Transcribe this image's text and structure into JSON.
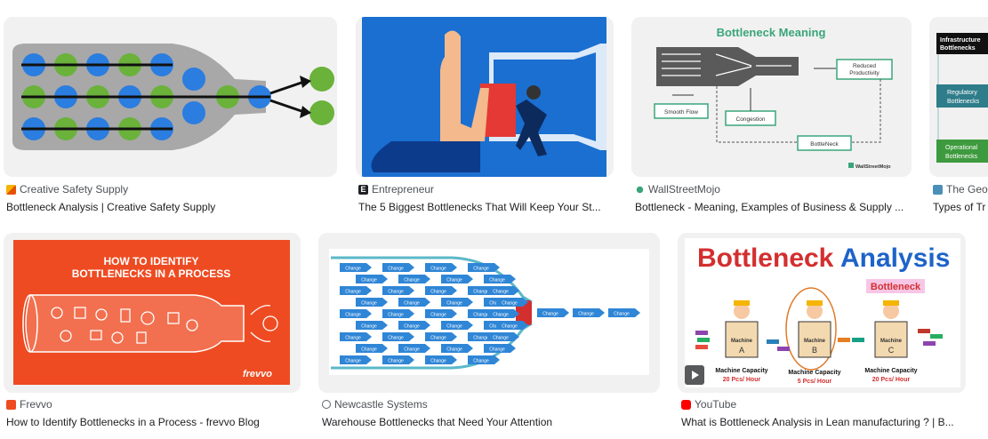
{
  "row1": [
    {
      "source": "Creative Safety Supply",
      "title": "Bottleneck Analysis | Creative Safety Supply"
    },
    {
      "source": "Entrepreneur",
      "title": "The 5 Biggest Bottlenecks That Will Keep Your St..."
    },
    {
      "source": "WallStreetMojo",
      "title": "Bottleneck - Meaning, Examples of Business & Supply ..."
    },
    {
      "source": "The Geo",
      "title": "Types of Tr"
    }
  ],
  "row2": [
    {
      "source": "Frevvo",
      "title": "How to Identify Bottlenecks in a Process - frevvo Blog"
    },
    {
      "source": "Newcastle Systems",
      "title": "Warehouse Bottlenecks that Need Your Attention"
    },
    {
      "source": "YouTube",
      "title": "What is Bottleneck Analysis in Lean manufacturing ? | B..."
    }
  ],
  "images": {
    "wsm": {
      "heading": "Bottleneck Meaning",
      "reduced": "Reduced",
      "productivity": "Productivity",
      "smooth_flow": "Smooth Flow",
      "congestion": "Congestion",
      "bottleneck": "BottleNeck",
      "logo": "WallStreetMojo"
    },
    "geo": {
      "infra1": "Infrastructure",
      "infra2": "Bottlenecks",
      "reg1": "Regulatory",
      "reg2": "Bottlenecks",
      "op1": "Operational",
      "op2": "Bottlenecks"
    },
    "frevvo": {
      "line1": "HOW TO IDENTIFY",
      "line2": "BOTTLENECKS IN A PROCESS",
      "logo": "frevvo"
    },
    "newcastle": {
      "arrow_label": "Change"
    },
    "youtube": {
      "title_part1": "Bottleneck",
      "title_part2": "Analysis",
      "callout": "Bottleneck",
      "machine_a": "Machine",
      "a_letter": "A",
      "machine_b": "Machine",
      "b_letter": "B",
      "machine_c": "Machine",
      "c_letter": "C",
      "cap_label_a": "Machine Capacity",
      "cap_val_a": "20 Pcs/ Hour",
      "cap_label_b": "Machine Capacity",
      "cap_val_b": "5 Pcs/ Hour",
      "cap_label_c": "Machine Capacity",
      "cap_val_c": "20 Pcs/ Hour"
    }
  },
  "colors": {
    "wsm_green": "#3aa57a",
    "frevvo_orange": "#ee4b22",
    "youtube_red": "#ff0000",
    "entrepreneur_blue": "#1565c0"
  },
  "icons": [
    "creative-safety-favicon",
    "entrepreneur-favicon",
    "wallstreetmojo-favicon",
    "the-geo-favicon",
    "frevvo-favicon",
    "globe-icon",
    "youtube-favicon",
    "play-icon"
  ]
}
